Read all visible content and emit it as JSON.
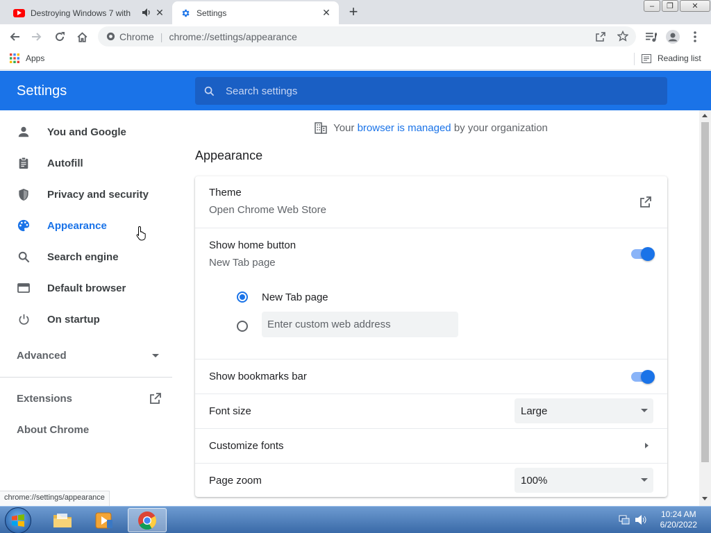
{
  "tabs": [
    {
      "label": "Destroying Windows 7 with",
      "active": false
    },
    {
      "label": "Settings",
      "active": true
    }
  ],
  "window_controls": {
    "minimize": "–",
    "restore": "❐",
    "close": "✕"
  },
  "toolbar": {
    "chip_label": "Chrome",
    "url": "chrome://settings/appearance"
  },
  "bookmarks": {
    "apps_label": "Apps",
    "reading_list_label": "Reading list"
  },
  "header": {
    "title": "Settings",
    "search_placeholder": "Search settings"
  },
  "sidebar": {
    "items": [
      {
        "label": "You and Google",
        "icon": "person-icon"
      },
      {
        "label": "Autofill",
        "icon": "clipboard-icon"
      },
      {
        "label": "Privacy and security",
        "icon": "shield-icon"
      },
      {
        "label": "Appearance",
        "icon": "palette-icon",
        "active": true
      },
      {
        "label": "Search engine",
        "icon": "search-icon"
      },
      {
        "label": "Default browser",
        "icon": "browser-window-icon"
      },
      {
        "label": "On startup",
        "icon": "power-icon"
      }
    ],
    "advanced_label": "Advanced",
    "extensions_label": "Extensions",
    "about_label": "About Chrome"
  },
  "managed_notice": {
    "prefix": "Your",
    "link": "browser is managed",
    "suffix": "by your organization"
  },
  "section_title": "Appearance",
  "appearance": {
    "theme_title": "Theme",
    "theme_sub": "Open Chrome Web Store",
    "home_title": "Show home button",
    "home_sub": "New Tab page",
    "home_enabled": true,
    "radio_newtab_label": "New Tab page",
    "custom_placeholder": "Enter custom web address",
    "bookmarks_bar_label": "Show bookmarks bar",
    "bookmarks_bar_enabled": true,
    "font_size_label": "Font size",
    "font_size_value": "Large",
    "customize_fonts_label": "Customize fonts",
    "page_zoom_label": "Page zoom",
    "page_zoom_value": "100%"
  },
  "status_url": "chrome://settings/appearance",
  "taskbar": {
    "time": "10:24 AM",
    "date": "6/20/2022"
  },
  "colors": {
    "accent": "#1a73e8",
    "header_bg": "#1a73e8",
    "toggle_track": "#8ab4f8"
  }
}
